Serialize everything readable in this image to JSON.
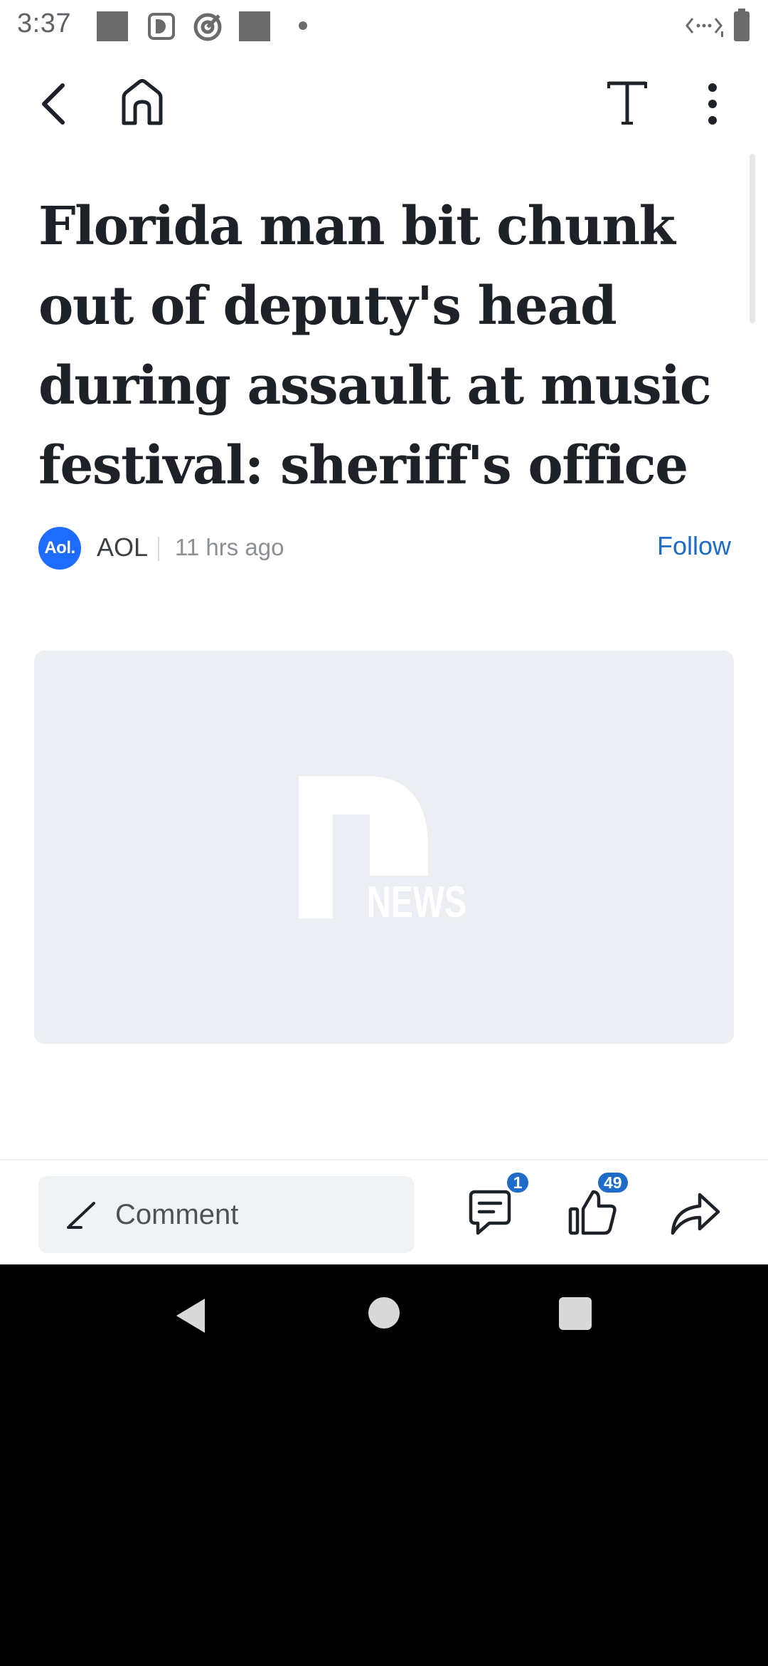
{
  "status_bar": {
    "time": "3:37",
    "icons": [
      "notification-square-icon",
      "dnews-app-icon",
      "target-icon",
      "notification-square-icon",
      "dot-icon",
      "data-arrows-icon",
      "battery-icon"
    ]
  },
  "app_bar": {
    "icons": [
      "back-arrow-icon",
      "home-icon",
      "text-size-icon",
      "more-vertical-icon"
    ]
  },
  "article": {
    "headline": "Florida man bit chunk out of deputy's head during assault at music festival: sheriff's office",
    "source_logo_text": "Aol.",
    "source_name": "AOL",
    "time_ago": "11 hrs ago",
    "follow_label": "Follow",
    "image_watermark": "NEWS"
  },
  "action_bar": {
    "comment_placeholder": "Comment",
    "comments_count": "1",
    "likes_count": "49"
  },
  "colors": {
    "accent": "#1e6bc8",
    "aol_blue": "#1e6bff",
    "headline": "#1d2228",
    "image_bg": "#ebeff3"
  }
}
